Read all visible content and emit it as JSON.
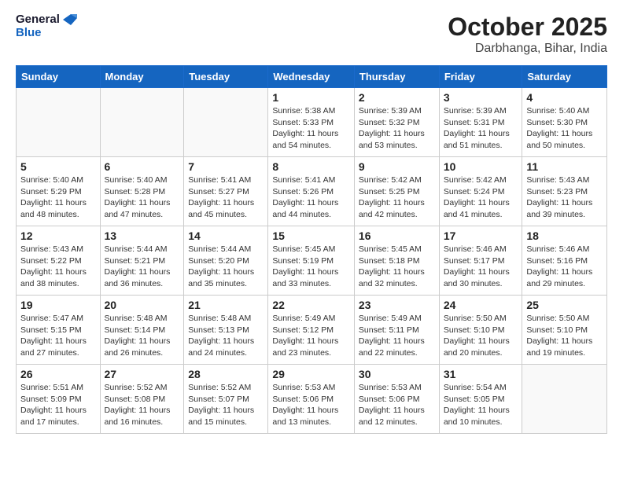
{
  "header": {
    "logo_line1": "General",
    "logo_line2": "Blue",
    "month": "October 2025",
    "location": "Darbhanga, Bihar, India"
  },
  "weekdays": [
    "Sunday",
    "Monday",
    "Tuesday",
    "Wednesday",
    "Thursday",
    "Friday",
    "Saturday"
  ],
  "weeks": [
    [
      {
        "day": "",
        "info": ""
      },
      {
        "day": "",
        "info": ""
      },
      {
        "day": "",
        "info": ""
      },
      {
        "day": "1",
        "info": "Sunrise: 5:38 AM\nSunset: 5:33 PM\nDaylight: 11 hours\nand 54 minutes."
      },
      {
        "day": "2",
        "info": "Sunrise: 5:39 AM\nSunset: 5:32 PM\nDaylight: 11 hours\nand 53 minutes."
      },
      {
        "day": "3",
        "info": "Sunrise: 5:39 AM\nSunset: 5:31 PM\nDaylight: 11 hours\nand 51 minutes."
      },
      {
        "day": "4",
        "info": "Sunrise: 5:40 AM\nSunset: 5:30 PM\nDaylight: 11 hours\nand 50 minutes."
      }
    ],
    [
      {
        "day": "5",
        "info": "Sunrise: 5:40 AM\nSunset: 5:29 PM\nDaylight: 11 hours\nand 48 minutes."
      },
      {
        "day": "6",
        "info": "Sunrise: 5:40 AM\nSunset: 5:28 PM\nDaylight: 11 hours\nand 47 minutes."
      },
      {
        "day": "7",
        "info": "Sunrise: 5:41 AM\nSunset: 5:27 PM\nDaylight: 11 hours\nand 45 minutes."
      },
      {
        "day": "8",
        "info": "Sunrise: 5:41 AM\nSunset: 5:26 PM\nDaylight: 11 hours\nand 44 minutes."
      },
      {
        "day": "9",
        "info": "Sunrise: 5:42 AM\nSunset: 5:25 PM\nDaylight: 11 hours\nand 42 minutes."
      },
      {
        "day": "10",
        "info": "Sunrise: 5:42 AM\nSunset: 5:24 PM\nDaylight: 11 hours\nand 41 minutes."
      },
      {
        "day": "11",
        "info": "Sunrise: 5:43 AM\nSunset: 5:23 PM\nDaylight: 11 hours\nand 39 minutes."
      }
    ],
    [
      {
        "day": "12",
        "info": "Sunrise: 5:43 AM\nSunset: 5:22 PM\nDaylight: 11 hours\nand 38 minutes."
      },
      {
        "day": "13",
        "info": "Sunrise: 5:44 AM\nSunset: 5:21 PM\nDaylight: 11 hours\nand 36 minutes."
      },
      {
        "day": "14",
        "info": "Sunrise: 5:44 AM\nSunset: 5:20 PM\nDaylight: 11 hours\nand 35 minutes."
      },
      {
        "day": "15",
        "info": "Sunrise: 5:45 AM\nSunset: 5:19 PM\nDaylight: 11 hours\nand 33 minutes."
      },
      {
        "day": "16",
        "info": "Sunrise: 5:45 AM\nSunset: 5:18 PM\nDaylight: 11 hours\nand 32 minutes."
      },
      {
        "day": "17",
        "info": "Sunrise: 5:46 AM\nSunset: 5:17 PM\nDaylight: 11 hours\nand 30 minutes."
      },
      {
        "day": "18",
        "info": "Sunrise: 5:46 AM\nSunset: 5:16 PM\nDaylight: 11 hours\nand 29 minutes."
      }
    ],
    [
      {
        "day": "19",
        "info": "Sunrise: 5:47 AM\nSunset: 5:15 PM\nDaylight: 11 hours\nand 27 minutes."
      },
      {
        "day": "20",
        "info": "Sunrise: 5:48 AM\nSunset: 5:14 PM\nDaylight: 11 hours\nand 26 minutes."
      },
      {
        "day": "21",
        "info": "Sunrise: 5:48 AM\nSunset: 5:13 PM\nDaylight: 11 hours\nand 24 minutes."
      },
      {
        "day": "22",
        "info": "Sunrise: 5:49 AM\nSunset: 5:12 PM\nDaylight: 11 hours\nand 23 minutes."
      },
      {
        "day": "23",
        "info": "Sunrise: 5:49 AM\nSunset: 5:11 PM\nDaylight: 11 hours\nand 22 minutes."
      },
      {
        "day": "24",
        "info": "Sunrise: 5:50 AM\nSunset: 5:10 PM\nDaylight: 11 hours\nand 20 minutes."
      },
      {
        "day": "25",
        "info": "Sunrise: 5:50 AM\nSunset: 5:10 PM\nDaylight: 11 hours\nand 19 minutes."
      }
    ],
    [
      {
        "day": "26",
        "info": "Sunrise: 5:51 AM\nSunset: 5:09 PM\nDaylight: 11 hours\nand 17 minutes."
      },
      {
        "day": "27",
        "info": "Sunrise: 5:52 AM\nSunset: 5:08 PM\nDaylight: 11 hours\nand 16 minutes."
      },
      {
        "day": "28",
        "info": "Sunrise: 5:52 AM\nSunset: 5:07 PM\nDaylight: 11 hours\nand 15 minutes."
      },
      {
        "day": "29",
        "info": "Sunrise: 5:53 AM\nSunset: 5:06 PM\nDaylight: 11 hours\nand 13 minutes."
      },
      {
        "day": "30",
        "info": "Sunrise: 5:53 AM\nSunset: 5:06 PM\nDaylight: 11 hours\nand 12 minutes."
      },
      {
        "day": "31",
        "info": "Sunrise: 5:54 AM\nSunset: 5:05 PM\nDaylight: 11 hours\nand 10 minutes."
      },
      {
        "day": "",
        "info": ""
      }
    ]
  ]
}
